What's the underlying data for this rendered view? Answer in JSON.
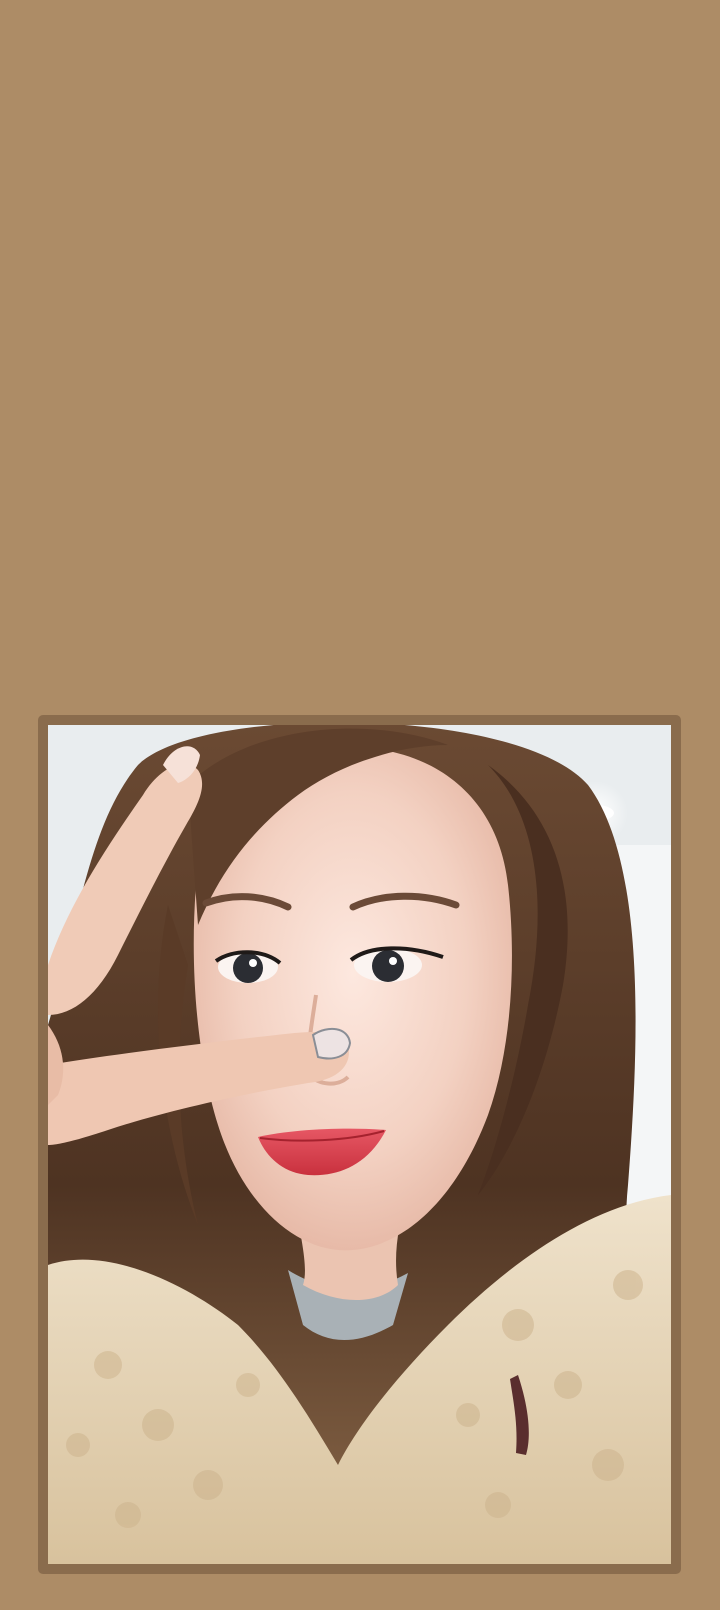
{
  "screen": {
    "background_color": "#ad8c66"
  },
  "photo_frame": {
    "border_color": "#8a6c4d"
  },
  "photo": {
    "subject": "selfie portrait",
    "colors": {
      "background": "#eef2f4",
      "hair": "#5a3b26",
      "skin": "#f2d2c3",
      "lips": "#d9404b",
      "jacket": "#e8d8bc"
    }
  }
}
